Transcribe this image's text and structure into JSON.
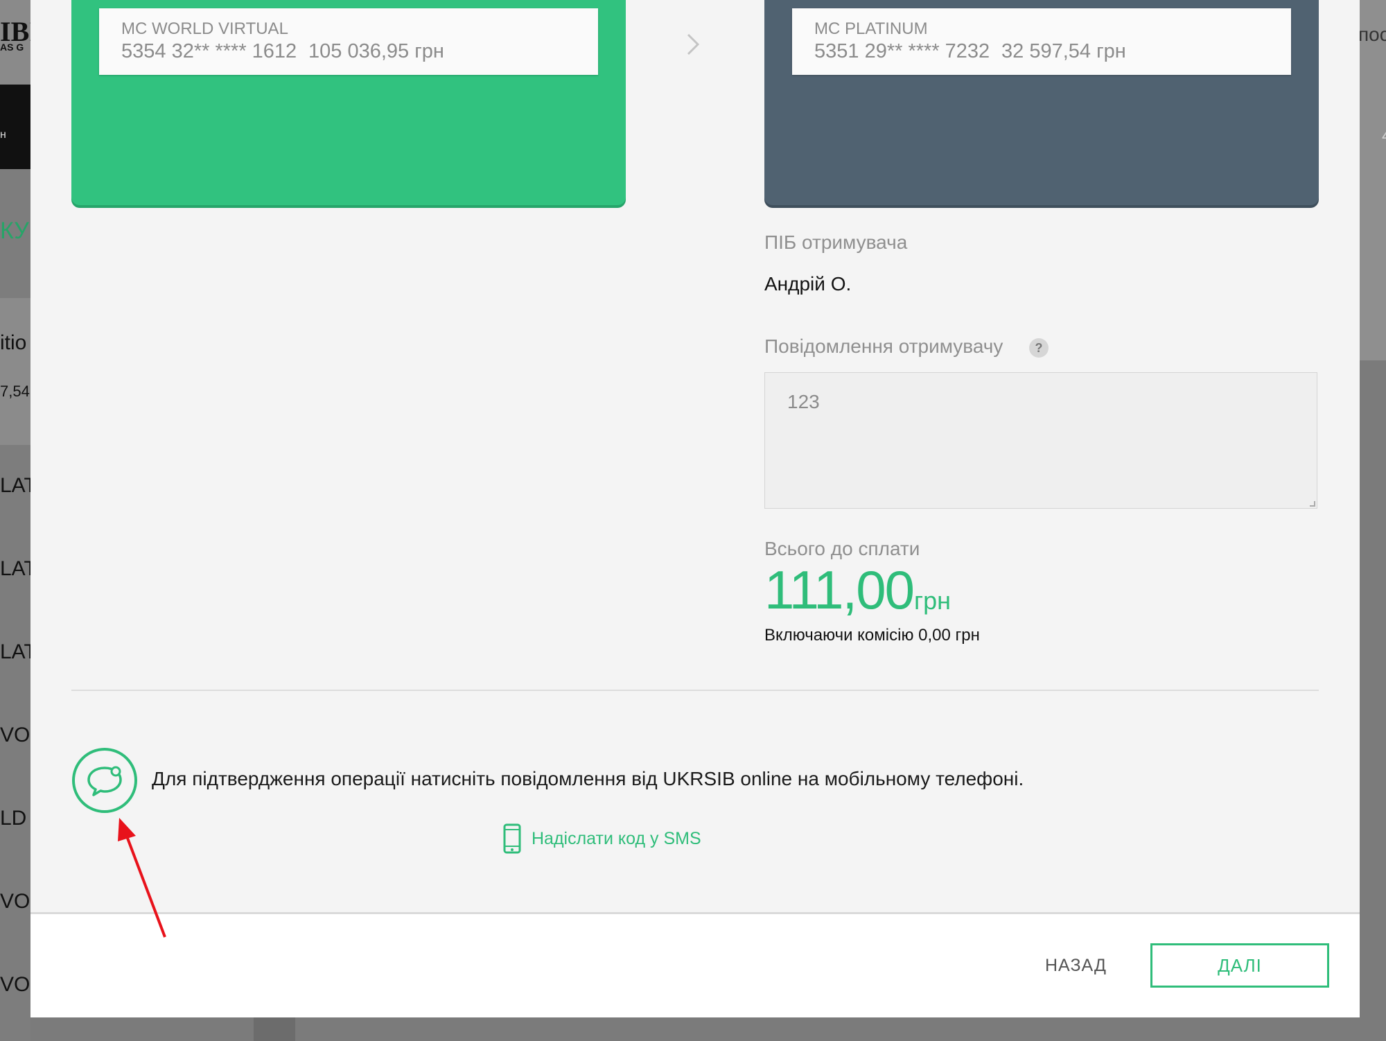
{
  "background": {
    "logo_text": "IBI",
    "logo_subtext": "AS G",
    "menu_fragment": "н",
    "section_fragment": "КУН",
    "right_fragment": "пос",
    "right_badge": "4",
    "side_items": [
      {
        "text": "itio"
      },
      {
        "text": "7,54"
      },
      {
        "text": "LAT"
      },
      {
        "text": "LAT"
      },
      {
        "text": "LAT"
      },
      {
        "text": "VOR"
      },
      {
        "text": "LD E"
      },
      {
        "text": "VOR"
      },
      {
        "text": "VOR"
      }
    ]
  },
  "transfer": {
    "from_card": {
      "name": "MC WORLD VIRTUAL",
      "number": "5354 32** **** 1612",
      "balance": "105 036,95 грн",
      "color": "#31c27f"
    },
    "to_card": {
      "name": "MC PLATINUM",
      "number": "5351 29** **** 7232",
      "balance": "32 597,54 грн",
      "color": "#506271"
    },
    "recipient_label": "ПІБ отримувача",
    "recipient_name": "Андрій О.",
    "message_label": "Повідомлення отримувачу",
    "message_help": "?",
    "message_value": "123",
    "total_label": "Всього до сплати",
    "total_amount": "111,00",
    "total_currency": "грн",
    "commission": "Включаючи комісію 0,00 грн"
  },
  "confirmation": {
    "text": "Для підтвердження операції натисніть повідомлення від UKRSIB online на мобільному телефоні.",
    "sms_link": "Надіслати код у SMS"
  },
  "footer": {
    "back_label": "НАЗАД",
    "next_label": "ДАЛІ"
  },
  "colors": {
    "accent_green": "#2fbd7a",
    "annotation_red": "#e8121b"
  }
}
